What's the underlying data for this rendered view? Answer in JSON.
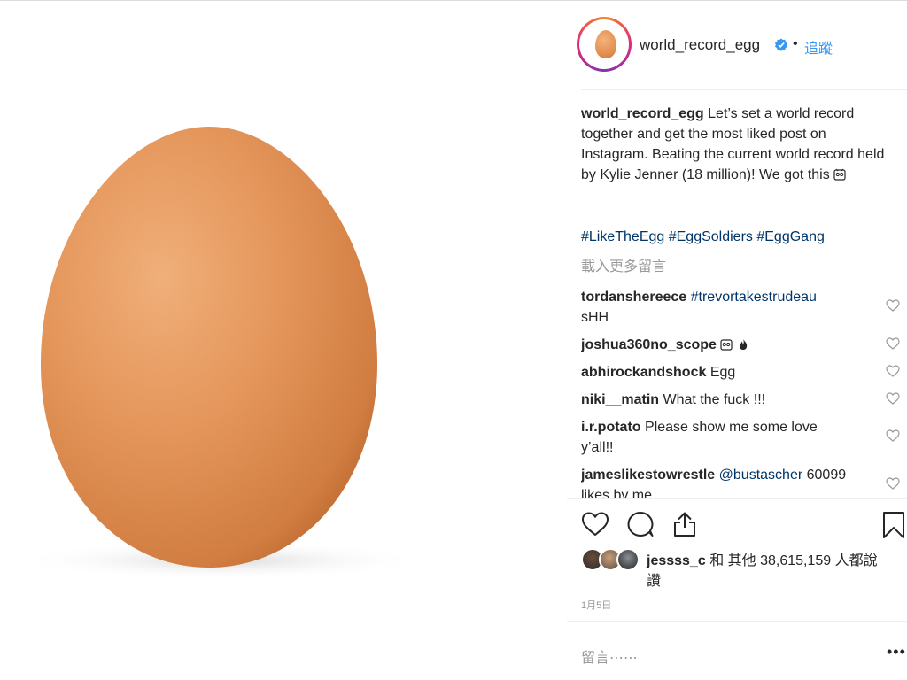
{
  "post": {
    "username": "world_record_egg",
    "follow_label": "追蹤",
    "separator": "•",
    "caption_user": "world_record_egg",
    "caption_text": "Let’s set a world record together and get the most liked post on Instagram. Beating the current world record held by Kylie Jenner (18 million)! We got this",
    "hashtags": "#LikeTheEgg #EggSoldiers #EggGang",
    "load_more": "載入更多留言"
  },
  "comments": [
    {
      "user": "tordanshereece",
      "tag": "#trevortakestrudeau",
      "text": "sHH"
    },
    {
      "user": "joshua360no_scope",
      "text": ""
    },
    {
      "user": "abhirockandshock",
      "text": "Egg"
    },
    {
      "user": "niki__matin",
      "text": "What the fuck !!!"
    },
    {
      "user": "i.r.potato",
      "text": "Please show me some love y’all!!"
    },
    {
      "user": "jameslikestowrestle",
      "tag": "@bustascher",
      "text": "60099 likes by me"
    }
  ],
  "likes": {
    "user": "jessss_c",
    "text": "和 其他 38,615,159 人都說讚"
  },
  "date": "1月5日",
  "comment_placeholder": "留言⋯⋯",
  "more_label": "•••",
  "icons": {
    "like": "heart-icon",
    "comment": "comment-icon",
    "share": "share-icon",
    "save": "bookmark-icon",
    "verified": "verified-badge-icon"
  },
  "colors": {
    "accent_blue": "#3897f0",
    "hashtag": "#003569",
    "egg": "#e08a4c"
  }
}
